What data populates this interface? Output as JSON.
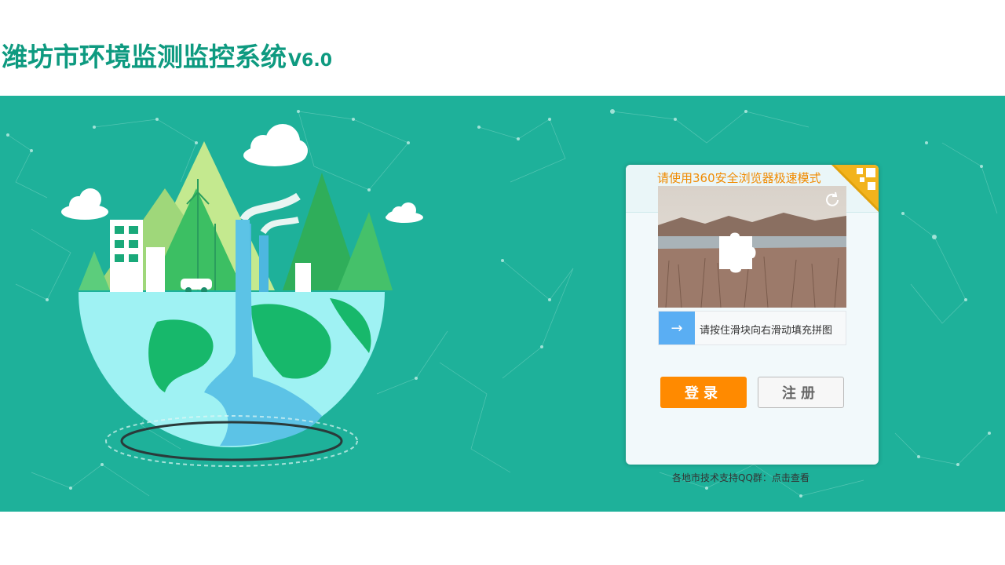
{
  "header": {
    "title": "潍坊市环境监测监控系统",
    "version": "V6.0"
  },
  "login_panel": {
    "browser_tip": "请使用360安全浏览器极速模式",
    "corner_badge_icon": "qr-code-icon",
    "captcha": {
      "refresh_icon": "refresh-icon",
      "slider_icon": "arrow-right-icon",
      "slider_instruction": "请按住滑块向右滑动填充拼图"
    },
    "buttons": {
      "login": "登录",
      "register": "注册"
    }
  },
  "footer": {
    "support_text": "各地市技术支持QQ群：",
    "support_link": "点击查看"
  },
  "colors": {
    "brand_green": "#1eb19a",
    "title_green": "#0e9a80",
    "accent_orange": "#ff8a00",
    "slider_blue": "#5aaef3"
  }
}
